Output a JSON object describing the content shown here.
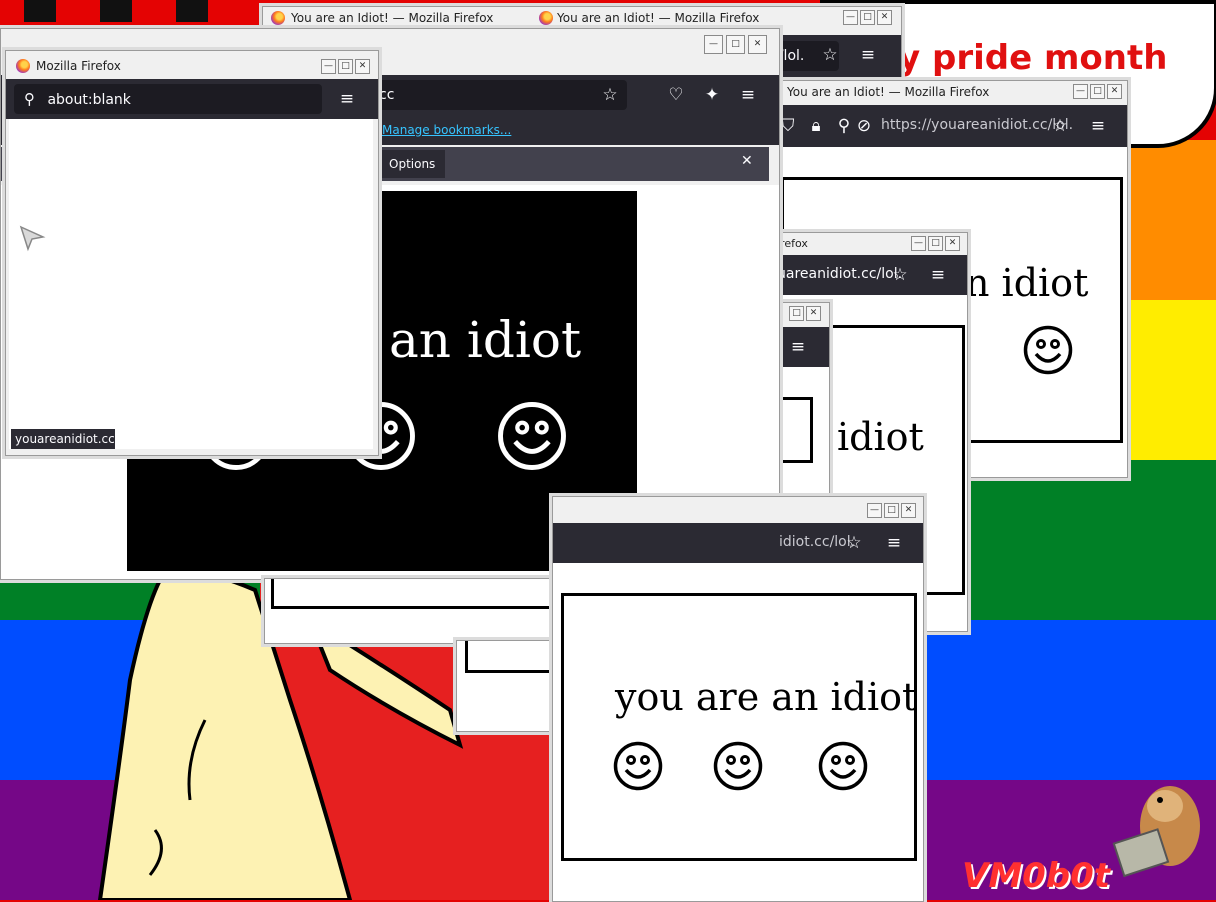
{
  "desktop": {
    "flag_colors": [
      "#e40303",
      "#ff8c00",
      "#ffed00",
      "#008026",
      "#004dff",
      "#750787"
    ],
    "banner_text": "y pride month",
    "watermark": "VM0b0t"
  },
  "windows": {
    "back_top": {
      "title": "You are an Idiot! — Mozilla Firefox"
    },
    "back_top2": {
      "title": "You are an Idiot! — Mozilla Firefox",
      "url_partial": ".cc/lol."
    },
    "main": {
      "url_partial": "cc",
      "bookmarks_link": "Manage bookmarks...",
      "options_label": "Options",
      "idiot_text": "an idiot"
    },
    "right_big": {
      "title": "You are an Idiot! — Mozilla Firefox",
      "url": "https://youareanidiot.cc/lol.",
      "idiot_text": "n idiot"
    },
    "mid_right": {
      "title": "irefox",
      "url_partial": "uareanidiot.cc/lol.",
      "idiot_text": "idiot"
    },
    "bottom_front": {
      "url_partial": "idiot.cc/lol.",
      "idiot_text": "you are an idiot"
    },
    "front_left": {
      "title": "Mozilla Firefox",
      "url": "about:blank",
      "status": "youareanidiot.cc"
    }
  },
  "icons": {
    "star": "star-icon",
    "menu": "hamburger-menu-icon",
    "search": "search-icon",
    "shield": "shield-icon",
    "lock": "lock-icon",
    "pocket": "pocket-icon",
    "extensions": "extensions-icon",
    "close": "close-icon"
  }
}
